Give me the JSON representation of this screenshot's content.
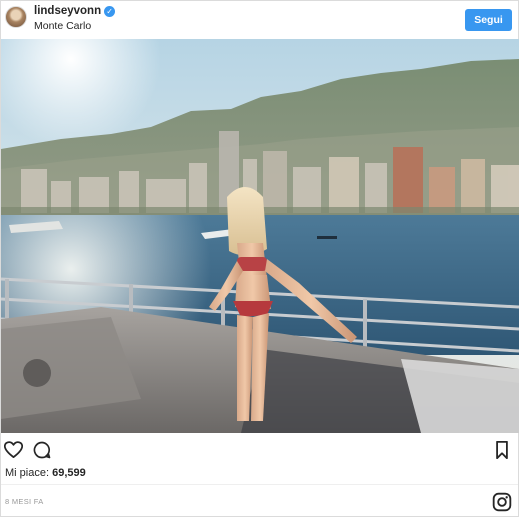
{
  "post": {
    "username": "lindseyvonn",
    "verified_badge": "verified-icon",
    "location": "Monte Carlo",
    "follow_label": "Segui",
    "likes_label": "Mi piace:",
    "likes_count": "69,599",
    "time_label": "8 MESI FA"
  },
  "icons": {
    "like": "heart-icon",
    "comment": "comment-icon",
    "save": "bookmark-icon",
    "brand": "instagram-logo-icon"
  },
  "colors": {
    "accent": "#3897f0",
    "text": "#262626",
    "muted": "#999999",
    "border": "#dbdbdb"
  }
}
